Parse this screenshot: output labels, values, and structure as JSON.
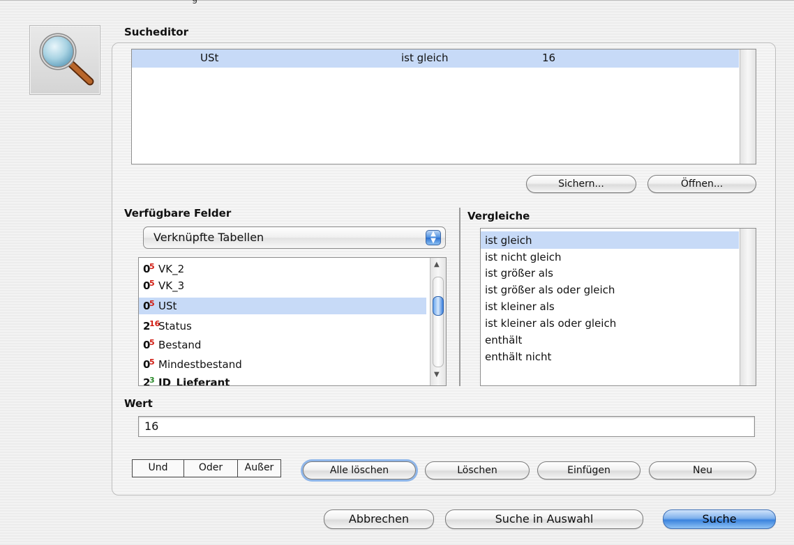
{
  "window": {
    "title_partial": "g"
  },
  "icon": "magnifier-icon",
  "sucheditor": {
    "heading": "Sucheditor",
    "rows": [
      {
        "field": "USt",
        "comparison": "ist gleich",
        "value": "16"
      }
    ],
    "save_label": "Sichern...",
    "open_label": "Öffnen..."
  },
  "fields": {
    "heading": "Verfügbare Felder",
    "popup_value": "Verknüpfte Tabellen",
    "items": [
      {
        "type": "0",
        "type_sup": "5",
        "label": "VK_2"
      },
      {
        "type": "0",
        "type_sup": "5",
        "label": "VK_3"
      },
      {
        "type": "0",
        "type_sup": "5",
        "label": "USt"
      },
      {
        "type": "2",
        "type_sup": "16",
        "label": "Status"
      },
      {
        "type": "0",
        "type_sup": "5",
        "label": "Bestand"
      },
      {
        "type": "0",
        "type_sup": "5",
        "label": "Mindestbestand"
      },
      {
        "type": "2",
        "type_sup": "3",
        "label": "ID_Lieferant"
      }
    ],
    "selected_label": "USt"
  },
  "comparisons": {
    "heading": "Vergleiche",
    "items": [
      "ist gleich",
      "ist nicht gleich",
      "ist größer als",
      "ist größer als oder gleich",
      "ist kleiner als",
      "ist kleiner als oder gleich",
      "enthält",
      "enthält nicht"
    ],
    "selected": "ist gleich"
  },
  "value": {
    "heading": "Wert",
    "current": "16"
  },
  "logic": {
    "and": "Und",
    "or": "Oder",
    "except": "Außer"
  },
  "actions": {
    "clear_all": "Alle löschen",
    "delete": "Löschen",
    "insert": "Einfügen",
    "new": "Neu"
  },
  "footer": {
    "cancel": "Abbrechen",
    "search_in_selection": "Suche in Auswahl",
    "search": "Suche"
  },
  "colors": {
    "selection": "#c7daf7",
    "default_button": "#3b83de",
    "type_badge": "#d01a10"
  }
}
